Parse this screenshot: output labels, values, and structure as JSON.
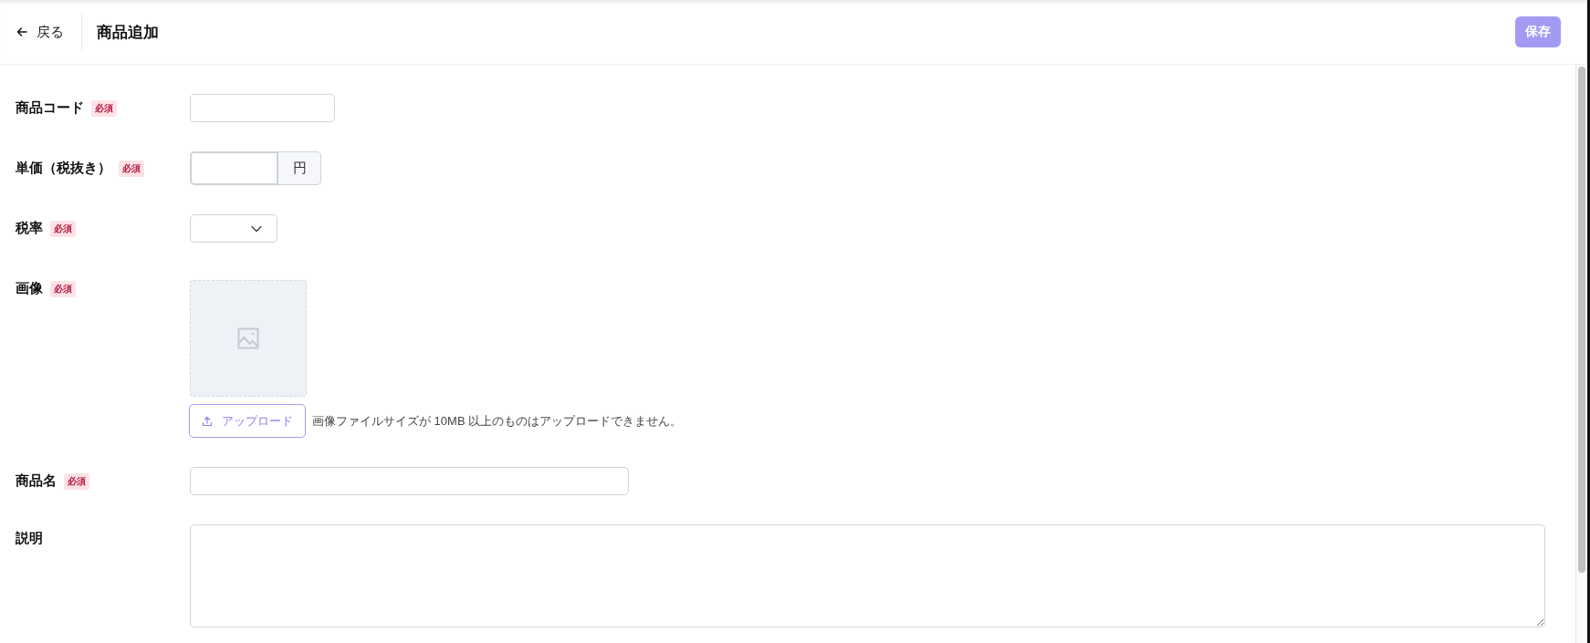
{
  "header": {
    "back": {
      "label": "戻る"
    },
    "title": "商品追加",
    "save": {
      "label": "保存",
      "disabled": true
    }
  },
  "fields": [
    {
      "kind": "short-text",
      "label": "商品コード",
      "badge": "必須"
    },
    {
      "kind": "price",
      "label": "単価（税抜き）",
      "badge": "必須",
      "unit": "円"
    },
    {
      "kind": "select",
      "label": "税率",
      "badge": "必須"
    },
    {
      "kind": "image",
      "label": "画像",
      "badge": "必須",
      "upload": "アップロード",
      "note": "画像ファイルサイズが 10MB 以上のものはアップロードできません。"
    },
    {
      "kind": "text",
      "label": "商品名",
      "badge": "必須"
    },
    {
      "kind": "textarea",
      "label": "説明"
    }
  ]
}
